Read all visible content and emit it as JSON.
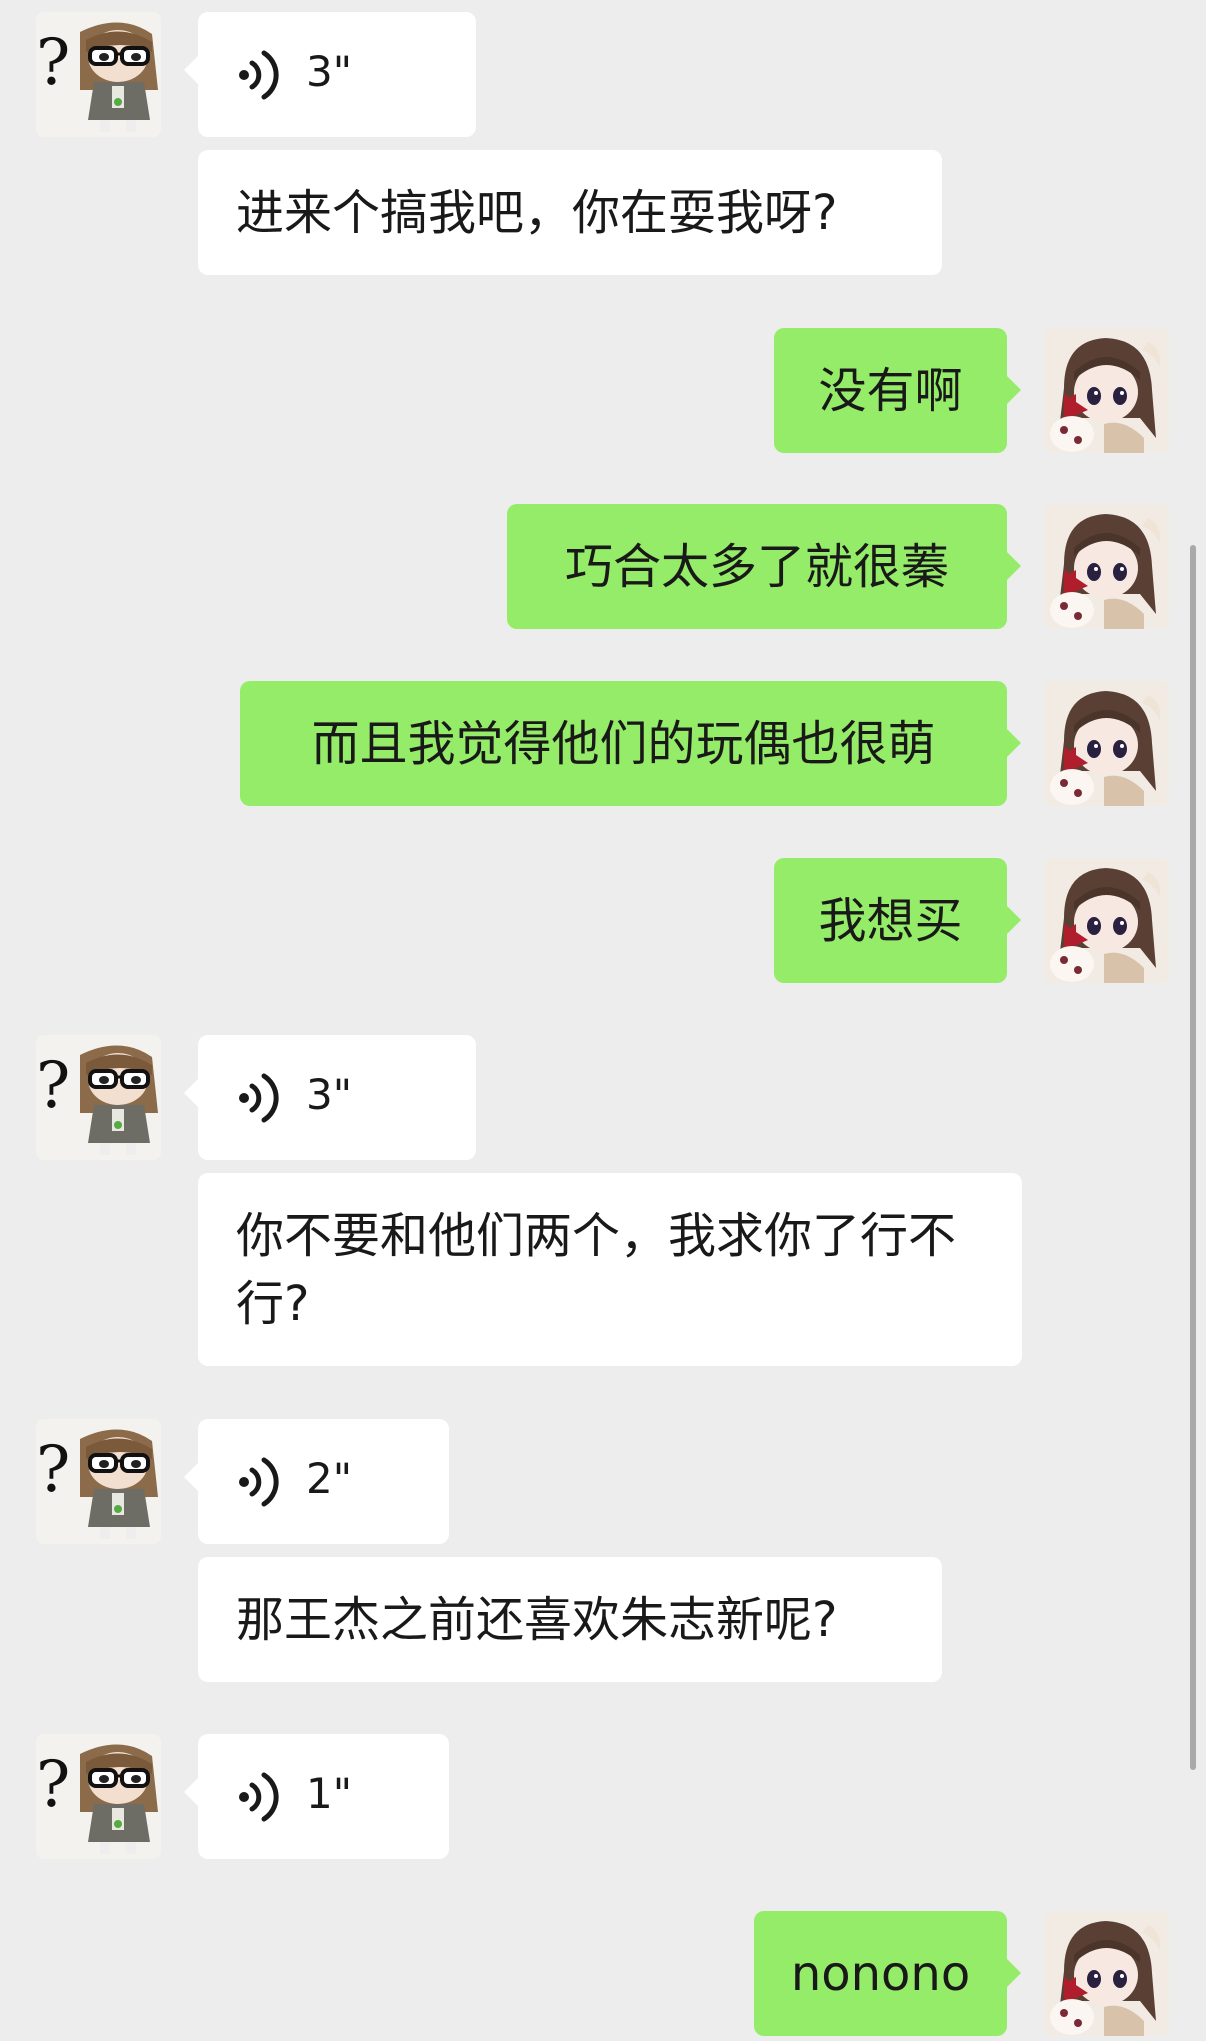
{
  "messages": [
    {
      "side": "left",
      "type": "voice",
      "avatar_icon": "glasses-girl-avatar-icon",
      "duration": "3\""
    },
    {
      "side": "left",
      "type": "text",
      "text": "进来个搞我吧，你在耍我呀?"
    },
    {
      "side": "right",
      "type": "text",
      "avatar_icon": "doll-avatar-icon",
      "text": "没有啊"
    },
    {
      "side": "right",
      "type": "text",
      "avatar_icon": "doll-avatar-icon",
      "text": "巧合太多了就很蓁"
    },
    {
      "side": "right",
      "type": "text",
      "avatar_icon": "doll-avatar-icon",
      "text": "而且我觉得他们的玩偶也很萌"
    },
    {
      "side": "right",
      "type": "text",
      "avatar_icon": "doll-avatar-icon",
      "text": "我想买"
    },
    {
      "side": "left",
      "type": "voice",
      "avatar_icon": "glasses-girl-avatar-icon",
      "duration": "3\""
    },
    {
      "side": "left",
      "type": "text",
      "text": "你不要和他们两个，我求你了行不行?"
    },
    {
      "side": "left",
      "type": "voice",
      "avatar_icon": "glasses-girl-avatar-icon",
      "duration": "2\""
    },
    {
      "side": "left",
      "type": "text",
      "text": "那王杰之前还喜欢朱志新呢?"
    },
    {
      "side": "left",
      "type": "voice",
      "avatar_icon": "glasses-girl-avatar-icon",
      "duration": "1\""
    },
    {
      "side": "right",
      "type": "text",
      "avatar_icon": "doll-avatar-icon",
      "text": "nonono"
    }
  ],
  "colors": {
    "background": "#ededed",
    "incoming_bubble": "#ffffff",
    "outgoing_bubble": "#95ec69",
    "text": "#191919"
  }
}
